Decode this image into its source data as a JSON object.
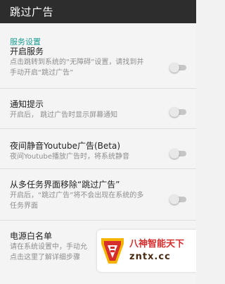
{
  "toolbar": {
    "title": "跳过广告"
  },
  "section": {
    "header": "服务设置"
  },
  "prefs": [
    {
      "title": "开启服务",
      "summary_line1": "点击跳转到系统的“无障碍”设置，请找到并",
      "summary_line2": "手动开启“跳过广告”",
      "checked": false
    },
    {
      "title": "通知提示",
      "summary_line1": "开启后， 跳过广告时显示屏幕通知",
      "checked": false
    },
    {
      "title": "夜间静音Youtube广告(Beta)",
      "summary_line1": "夜间Youtube播放广告时，将系统静音",
      "checked": false
    },
    {
      "title": "从多任务界面移除“跳过广告”",
      "summary_line1": "开启后，“跳过广告”将不会出现在系统的多",
      "summary_line2": "任务界面",
      "checked": false
    },
    {
      "title": "电源白名单",
      "summary_line1": "请在系统设置中，手动允",
      "summary_line2": "点击这里了解详细步骤"
    }
  ],
  "watermark": {
    "text": "八神智能天下",
    "url": "zntx.cc"
  },
  "colors": {
    "toolbar": "#2d2d2d",
    "accent": "#1e9e96",
    "switch_track_off": "#c6c6c6",
    "switch_thumb_off": "#e8e8e8",
    "watermark_red": "#d62d2d"
  }
}
